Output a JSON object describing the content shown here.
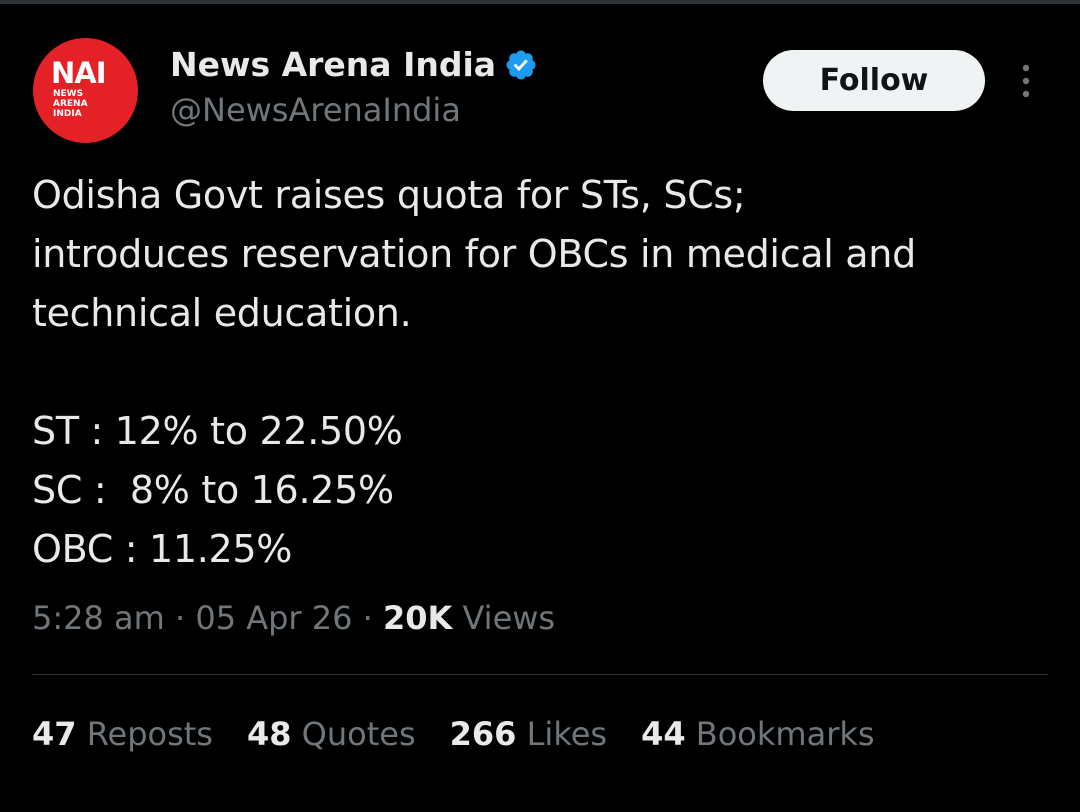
{
  "author": {
    "avatar_big": "NAI",
    "avatar_small": "NEWS\nARENA\nINDIA",
    "display_name": "News Arena India",
    "handle": "@NewsArenaIndia",
    "verified_icon": "verified-badge-icon",
    "avatar_color": "#e32126",
    "verified_color": "#1d9bf0"
  },
  "follow_label": "Follow",
  "more_icon": "more-vertical-icon",
  "tweet": {
    "text": "Odisha Govt raises quota for STs, SCs;\nintroduces reservation for OBCs in medical and\ntechnical education.\n\nST : 12% to 22.50%\nSC :  8% to 16.25%\nOBC : 11.25%"
  },
  "meta": {
    "time": "5:28 am",
    "sep1": " · ",
    "date": "05 Apr 26",
    "sep2": " · ",
    "views_count": "20K",
    "views_label": " Views"
  },
  "stats": [
    {
      "count": "47",
      "label": " Reposts"
    },
    {
      "count": "48",
      "label": " Quotes"
    },
    {
      "count": "266",
      "label": " Likes"
    },
    {
      "count": "44",
      "label": " Bookmarks"
    }
  ],
  "colors": {
    "background": "#000000",
    "text_primary": "#e7e9ea",
    "text_secondary": "#71767b",
    "divider": "#2f3336",
    "button_bg": "#eff3f4"
  }
}
